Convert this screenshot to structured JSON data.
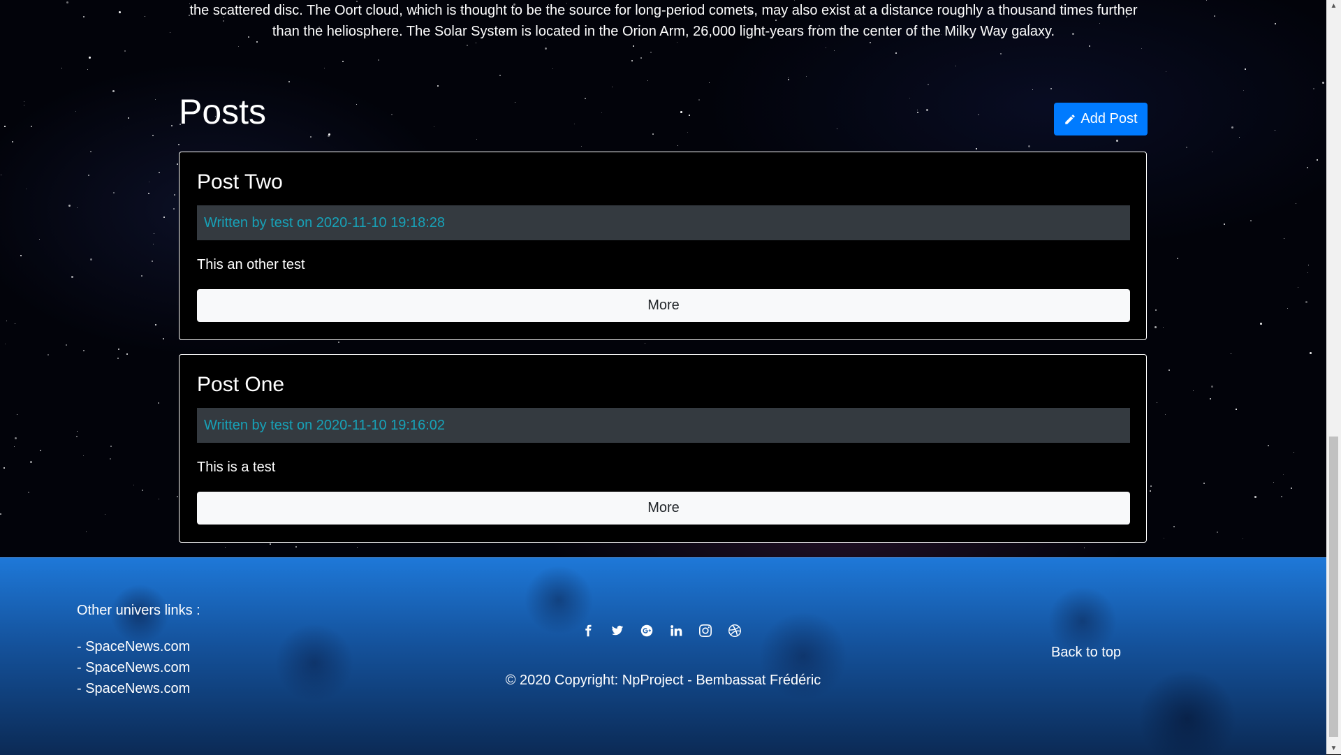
{
  "intro": {
    "line1": "the scattered disc. The Oort cloud, which is thought to be the source for long-period comets, may also exist at a distance roughly a thousand times further",
    "line2": "than the heliosphere. The Solar System is located in the Orion Arm, 26,000 light-years from the center of the Milky Way galaxy."
  },
  "posts": {
    "title": "Posts",
    "add_label": "Add Post",
    "items": [
      {
        "title": "Post Two",
        "meta": "Written by test on 2020-11-10 19:18:28",
        "body": "This an other test",
        "more_label": "More"
      },
      {
        "title": "Post One",
        "meta": "Written by test on 2020-11-10 19:16:02",
        "body": "This is a test",
        "more_label": "More"
      }
    ]
  },
  "footer": {
    "links_heading": "Other univers links :",
    "links": [
      "- SpaceNews.com",
      "- SpaceNews.com",
      "- SpaceNews.com"
    ],
    "social_icons": [
      "facebook-icon",
      "twitter-icon",
      "google-plus-icon",
      "linkedin-icon",
      "instagram-icon",
      "dribbble-icon"
    ],
    "copyright": "© 2020 Copyright: NpProject - Bembassat Frédéric",
    "back_to_top": "Back to top"
  },
  "colors": {
    "accent": "#007bff",
    "meta_text": "#17a2b8",
    "meta_bg": "#343a40",
    "footer_blue": "#1e78d8"
  }
}
